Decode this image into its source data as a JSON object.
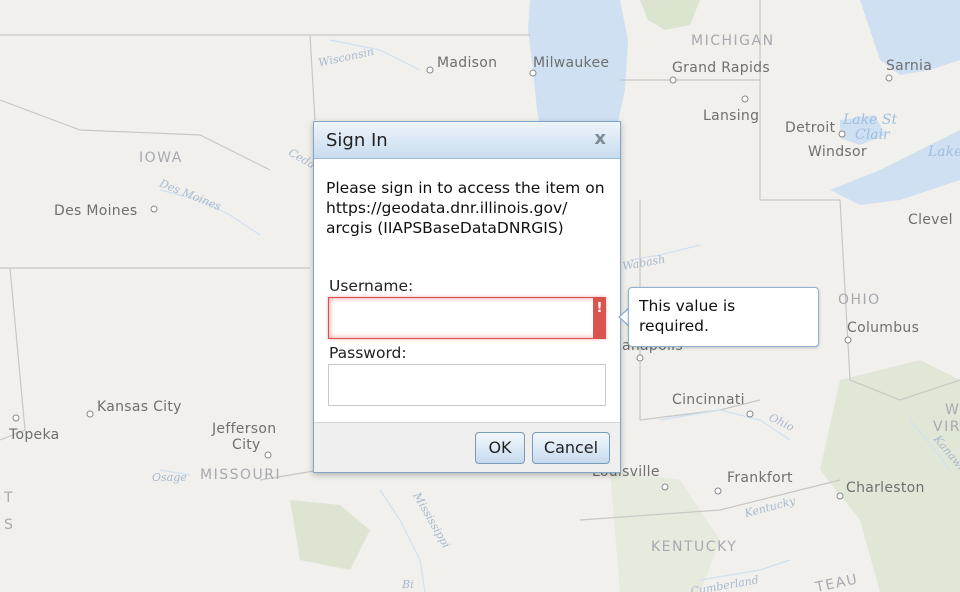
{
  "map": {
    "cities": [
      {
        "name": "Madison",
        "key": "madison"
      },
      {
        "name": "Milwaukee",
        "key": "milwaukee"
      },
      {
        "name": "Grand Rapids",
        "key": "grand-rapids"
      },
      {
        "name": "Lansing",
        "key": "lansing"
      },
      {
        "name": "Detroit",
        "key": "detroit"
      },
      {
        "name": "Windsor",
        "key": "windsor"
      },
      {
        "name": "Sarnia",
        "key": "sarnia"
      },
      {
        "name": "Des Moines",
        "key": "des-moines"
      },
      {
        "name": "Kansas City",
        "key": "kansas-city"
      },
      {
        "name": "Topeka",
        "key": "topeka"
      },
      {
        "name": "Jefferson",
        "key": "jefferson"
      },
      {
        "name": "City",
        "key": "jefferson-city-2"
      },
      {
        "name": "Columbus",
        "key": "columbus"
      },
      {
        "name": "Cincinnati",
        "key": "cincinnati"
      },
      {
        "name": "Frankfort",
        "key": "frankfort"
      },
      {
        "name": "Charleston",
        "key": "charleston"
      },
      {
        "name": "Louisville",
        "key": "louisville"
      },
      {
        "name": "Clevel",
        "key": "cleveland"
      },
      {
        "name": "anapolis",
        "key": "indianapolis"
      }
    ],
    "states": [
      "MICHIGAN",
      "IOWA",
      "MISSOURI",
      "OHIO",
      "KENTUCKY",
      "W",
      "VIR",
      "TEAU",
      "T",
      "S"
    ],
    "water": [
      "Wisconsin",
      "Des Moines",
      "Cedar",
      "Wabash",
      "Ohio",
      "Kentucky",
      "Kanawha",
      "Mississippi",
      "Osage",
      "Cumberland",
      "Bi"
    ],
    "lakes": [
      "Lake St",
      "Clair",
      "Lake"
    ],
    "colors": {
      "background": "#f1f0ec",
      "water": "#cfe0f2",
      "park": "#dbe4cf",
      "border": "#c8c7c3"
    }
  },
  "dialog": {
    "title": "Sign In",
    "close_glyph": "x",
    "message": "Please sign in to access the item on\nhttps://geodata.dnr.illinois.gov/\narcgis (IIAPSBaseDataDNRGIS)",
    "username_label": "Username:",
    "username_value": "",
    "password_label": "Password:",
    "password_value": "",
    "error_glyph": "!",
    "ok_label": "OK",
    "cancel_label": "Cancel"
  },
  "tooltip": {
    "text": "This value is\nrequired."
  }
}
